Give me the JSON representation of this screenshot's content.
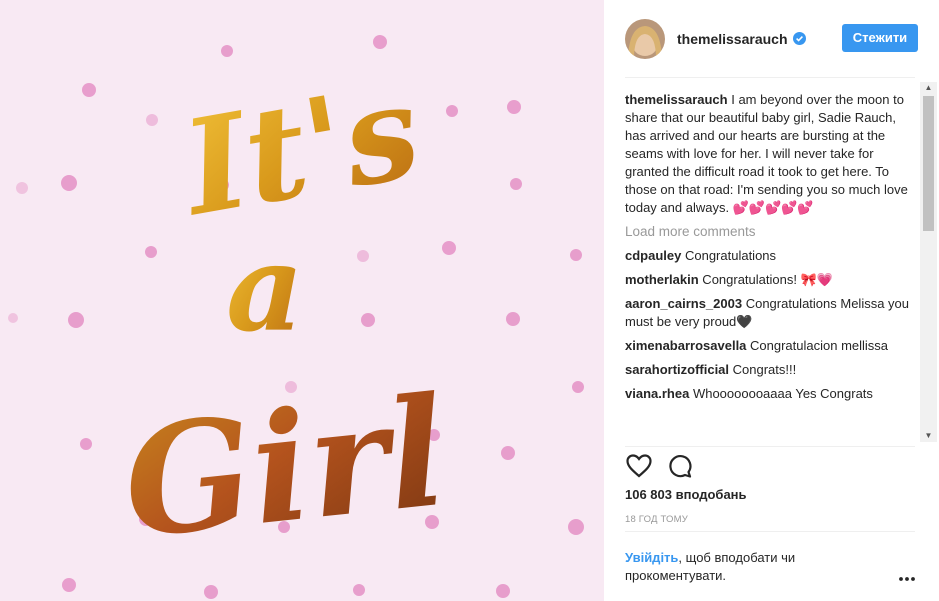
{
  "post": {
    "image_text": [
      "It's",
      "a",
      "Girl"
    ],
    "author": "themelissarauch",
    "follow_label": "Стежити",
    "caption_user": "themelissarauch",
    "caption_text": " I am beyond over the moon to share that our beautiful baby girl, Sadie Rauch, has arrived and our hearts are bursting at the seams with love for her. I will never take for granted the difficult road it took to get here. To those on that road: I'm sending you so much love today and always. 💕💕💕💕💕",
    "load_more": "Load more comments",
    "comments": [
      {
        "user": "cdpauley",
        "text": " Congratulations"
      },
      {
        "user": "motherlakin",
        "text": " Congratulations! 🎀💗"
      },
      {
        "user": "aaron_cairns_2003",
        "text": " Congratulations Melissa you must be very proud🖤"
      },
      {
        "user": "ximenabarrosavella",
        "text": " Congratulacion mellissa"
      },
      {
        "user": "sarahortizofficial",
        "text": " Congrats!!!"
      },
      {
        "user": "viana.rhea",
        "text": " Whoooooooaaaa Yes Congrats"
      }
    ],
    "likes": "106 803 вподобань",
    "timestamp": "18 ГОД ТОМУ",
    "login_link": "Увійдіть",
    "login_rest": ", щоб вподобати чи прокоментувати."
  },
  "icons": {
    "verified": "verified-badge-icon",
    "like": "heart-icon",
    "comment": "comment-bubble-icon",
    "more": "more-options-icon",
    "scroll_up": "▲",
    "scroll_down": "▼"
  },
  "colors": {
    "accent": "#3897f0",
    "image_background": "#f7e6f1",
    "dots": "#e38fc4",
    "gold": "#d9a021",
    "orange": "#c35b1a"
  }
}
